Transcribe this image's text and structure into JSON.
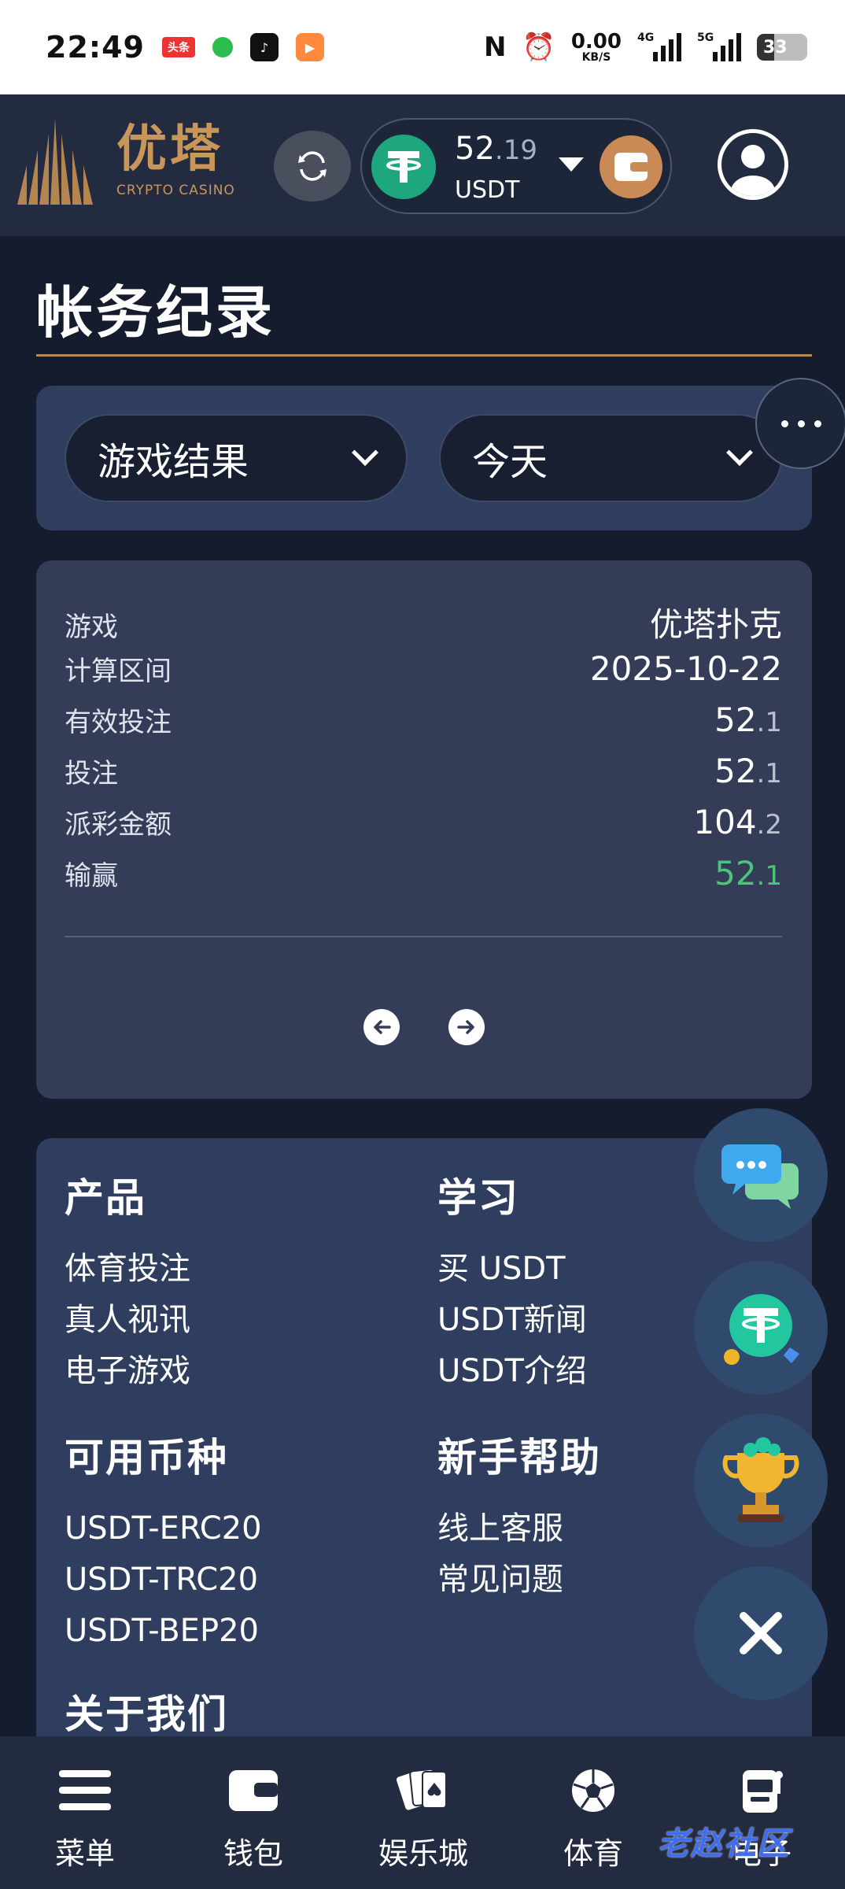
{
  "status_bar": {
    "time": "22:49",
    "news_app": "头条",
    "net_speed_value": "0.00",
    "net_speed_unit": "KB/S",
    "sim1": "4G",
    "sim2": "5G",
    "battery": "33"
  },
  "header": {
    "logo_cn": "优塔",
    "logo_en": "CRYPTO CASINO",
    "balance_int": "52",
    "balance_dec": ".19",
    "currency": "USDT"
  },
  "page": {
    "title": "帐务纪录"
  },
  "filters": {
    "type_value": "游戏结果",
    "period_value": "今天"
  },
  "record": {
    "rows": [
      {
        "label": "游戏",
        "value": "优塔扑克",
        "dec": ""
      },
      {
        "label": "计算区间",
        "value": "2025-10-22",
        "dec": ""
      },
      {
        "label": "有效投注",
        "value": "52",
        "dec": ".1"
      },
      {
        "label": "投注",
        "value": "52",
        "dec": ".1"
      },
      {
        "label": "派彩金额",
        "value": "104",
        "dec": ".2"
      },
      {
        "label": "输赢",
        "value": "52",
        "dec": ".1"
      }
    ]
  },
  "footer": {
    "products": {
      "heading": "产品",
      "links": [
        "体育投注",
        "真人视讯",
        "电子游戏"
      ]
    },
    "learn": {
      "heading": "学习",
      "links": [
        "买 USDT",
        "USDT新闻",
        "USDT介绍"
      ]
    },
    "currencies": {
      "heading": "可用币种",
      "links": [
        "USDT-ERC20",
        "USDT-TRC20",
        "USDT-BEP20"
      ]
    },
    "help": {
      "heading": "新手帮助",
      "links": [
        "线上客服",
        "常见问题"
      ]
    },
    "about": {
      "heading": "关于我们"
    }
  },
  "bottom_nav": {
    "items": [
      {
        "label": "菜单",
        "icon": "menu-icon"
      },
      {
        "label": "钱包",
        "icon": "wallet-icon"
      },
      {
        "label": "娱乐城",
        "icon": "cards-icon"
      },
      {
        "label": "体育",
        "icon": "soccer-ball-icon"
      },
      {
        "label": "电子",
        "icon": "slot-machine-icon"
      }
    ]
  },
  "watermark": "老赵社区",
  "colors": {
    "accent_gold": "#c9965a",
    "win_green": "#4cc57a",
    "usdt_green": "#1ea67e"
  }
}
